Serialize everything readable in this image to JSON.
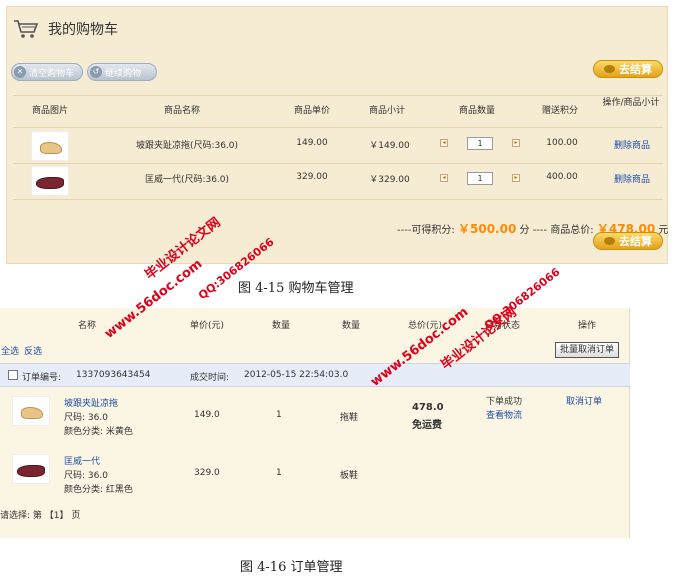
{
  "cart": {
    "title": "我的购物车",
    "clear_label": "清空购物车",
    "continue_label": "继续购物",
    "checkout_label": "去结算",
    "columns": [
      "商品图片",
      "商品名称",
      "商品单价",
      "商品小计",
      "商品数量",
      "赠送积分",
      "操作/商品小计"
    ],
    "items": [
      {
        "name": "坡跟夹趾凉拖(尺码:36.0)",
        "price": "149.00",
        "subtotal": "￥149.00",
        "qty": "1",
        "points": "100.00",
        "action": "删除商品"
      },
      {
        "name": "匡威一代(尺码:36.0)",
        "price": "329.00",
        "subtotal": "￥329.00",
        "qty": "1",
        "points": "400.00",
        "action": "删除商品"
      }
    ],
    "points_label": "----可得积分:",
    "points_value": "￥500.00",
    "points_unit": "分",
    "dash": "----",
    "total_label": "商品总价:",
    "total_value": "￥478.00",
    "total_unit": "元"
  },
  "captions": {
    "fig1": "图 4-15  购物车管理",
    "fig2": "图 4-16  订单管理"
  },
  "orders": {
    "columns": [
      "名称",
      "单价(元)",
      "数量",
      "数量",
      "总价(元)",
      "交易状态",
      "操作"
    ],
    "select_all": "全选",
    "invert": "反选",
    "batch_cancel": "批量取消订单",
    "order_no_label": "订单编号:",
    "order_no": "1337093643454",
    "time_label": "成交时间:",
    "time": "2012-05-15 22:54:03.0",
    "items": [
      {
        "name": "坡跟夹趾凉拖",
        "size": "尺码: 36.0",
        "color": "颜色分类: 米黄色",
        "price": "149.0",
        "qty": "1",
        "category": "拖鞋"
      },
      {
        "name": "匡威一代",
        "size": "尺码: 36.0",
        "color": "颜色分类: 红黑色",
        "price": "329.0",
        "qty": "1",
        "category": "板鞋"
      }
    ],
    "total": "478.0",
    "shipping": "免运费",
    "status": "下单成功",
    "logistics": "查看物流",
    "cancel": "取消订单",
    "pager_prefix": "请选择: 第",
    "pager_page": "【1】",
    "pager_suffix": "页"
  },
  "watermarks": {
    "site_name": "毕业设计论文网",
    "url": "www.56doc.com",
    "qq": "QQ:306826066"
  }
}
